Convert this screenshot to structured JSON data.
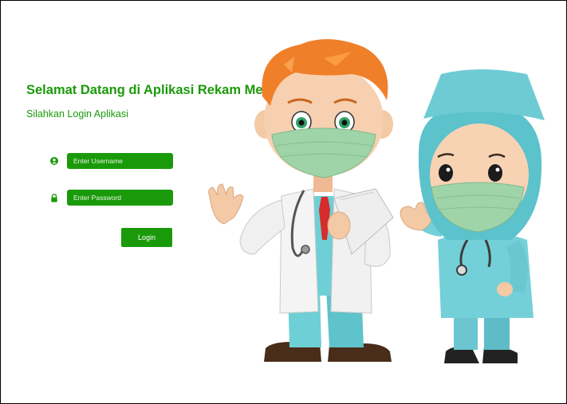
{
  "login": {
    "title": "Selamat Datang di Aplikasi Rekam Medis",
    "subtitle": "Silahkan Login Aplikasi",
    "username": {
      "placeholder": "Enter Username",
      "value": "",
      "icon": "user-circle-icon"
    },
    "password": {
      "placeholder": "Enter Password",
      "value": "",
      "icon": "lock-icon"
    },
    "button_label": "Login"
  },
  "colors": {
    "accent": "#1a9a0a",
    "field_text": "#e8f5e4",
    "background": "#ffffff"
  },
  "illustration": {
    "figures": [
      "doctor",
      "nurse"
    ]
  }
}
